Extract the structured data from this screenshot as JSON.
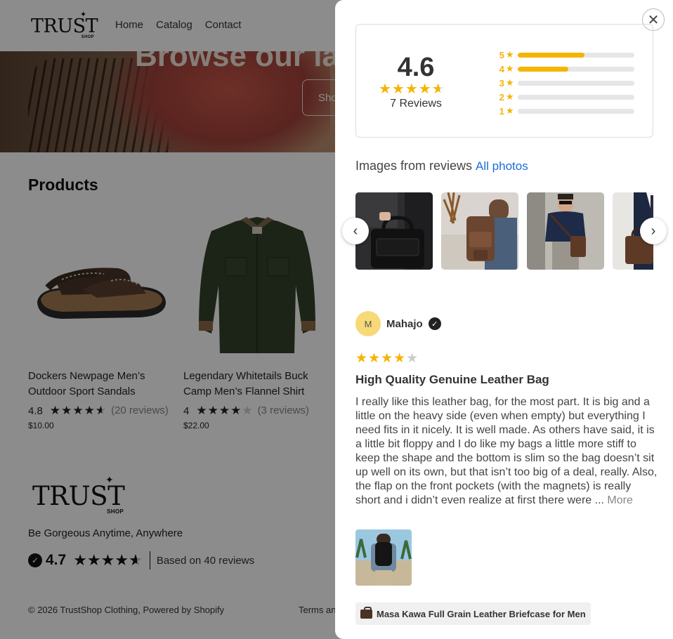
{
  "header": {
    "logo": {
      "word": "TRUST",
      "sub": "SHOP"
    },
    "nav": [
      "Home",
      "Catalog",
      "Contact"
    ]
  },
  "hero": {
    "heading": "Browse our la",
    "button_label": "Sho"
  },
  "products": {
    "title": "Products",
    "items": [
      {
        "name": "Dockers Newpage Men’s Outdoor Sport Sandals",
        "rating": "4.8",
        "stars": 4.5,
        "count": "(20 reviews)",
        "price": "$10.00"
      },
      {
        "name": "Legendary Whitetails Buck Camp Men’s Flannel Shirt",
        "rating": "4",
        "stars": 4,
        "count": "(3 reviews)",
        "price": "$22.00"
      }
    ]
  },
  "footer": {
    "logo": {
      "word": "TRUST",
      "sub": "SHOP"
    },
    "tagline": "Be Gorgeous Anytime, Anywhere",
    "rating": "4.7",
    "rating_stars": 4.5,
    "based_on": "Based on 40 reviews",
    "copyright": "© 2026 TrustShop Clothing, Powered by Shopify",
    "terms": "Terms an"
  },
  "reviews_drawer": {
    "summary": {
      "average": "4.6",
      "average_stars": 4.5,
      "count_label": "7 Reviews",
      "distribution": [
        {
          "stars": "5",
          "fraction": 0.57
        },
        {
          "stars": "4",
          "fraction": 0.43
        },
        {
          "stars": "3",
          "fraction": 0
        },
        {
          "stars": "2",
          "fraction": 0
        },
        {
          "stars": "1",
          "fraction": 0
        }
      ]
    },
    "images_heading": "Images from reviews",
    "all_photos_label": "All photos",
    "review": {
      "avatar_initial": "M",
      "name": "Mahajo",
      "stars": 4,
      "title": "High Quality Genuine Leather Bag",
      "body": "I really like this leather bag, for the most part. It is big and a little on the heavy side (even when empty) but everything I need fits in it nicely. It is well made. As others have said, it is a little bit floppy and I do like my bags a little more stiff to keep the shape and the bottom is slim so the bag doesn’t sit up well on its own, but that isn’t too big of a deal, really. Also, the flap on the front pockets (with the magnets) is really short and i didn’t even realize at first there were ...",
      "more_label": "More",
      "product_label": "Masa Kawa Full Grain Leather Briefcase for Men"
    },
    "colors": {
      "star": "#f5b400",
      "link": "#1a6ed8",
      "avatar": "#f7d978"
    }
  }
}
